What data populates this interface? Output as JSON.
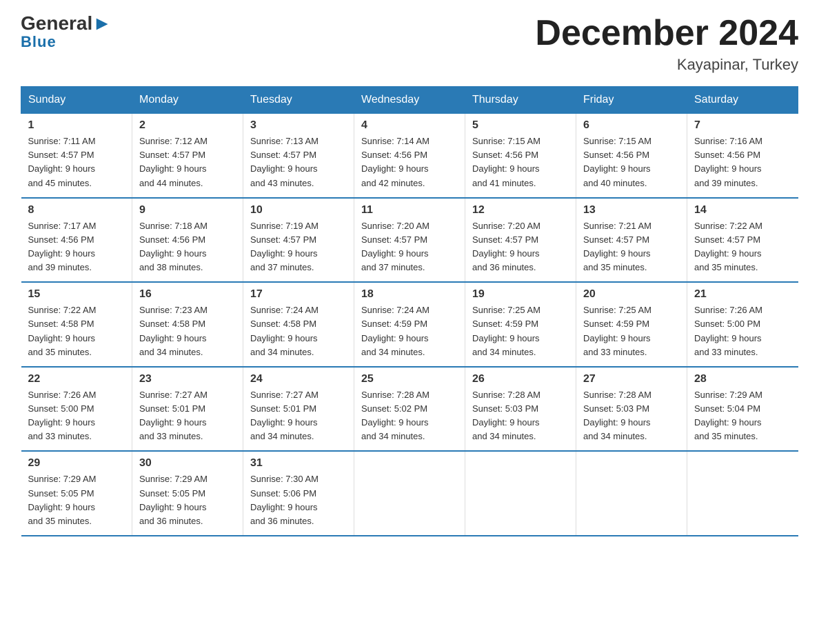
{
  "header": {
    "logo_general": "General",
    "logo_blue": "Blue",
    "month_title": "December 2024",
    "location": "Kayapinar, Turkey"
  },
  "days_of_week": [
    "Sunday",
    "Monday",
    "Tuesday",
    "Wednesday",
    "Thursday",
    "Friday",
    "Saturday"
  ],
  "weeks": [
    [
      {
        "num": "1",
        "sunrise": "7:11 AM",
        "sunset": "4:57 PM",
        "daylight": "9 hours and 45 minutes."
      },
      {
        "num": "2",
        "sunrise": "7:12 AM",
        "sunset": "4:57 PM",
        "daylight": "9 hours and 44 minutes."
      },
      {
        "num": "3",
        "sunrise": "7:13 AM",
        "sunset": "4:57 PM",
        "daylight": "9 hours and 43 minutes."
      },
      {
        "num": "4",
        "sunrise": "7:14 AM",
        "sunset": "4:56 PM",
        "daylight": "9 hours and 42 minutes."
      },
      {
        "num": "5",
        "sunrise": "7:15 AM",
        "sunset": "4:56 PM",
        "daylight": "9 hours and 41 minutes."
      },
      {
        "num": "6",
        "sunrise": "7:15 AM",
        "sunset": "4:56 PM",
        "daylight": "9 hours and 40 minutes."
      },
      {
        "num": "7",
        "sunrise": "7:16 AM",
        "sunset": "4:56 PM",
        "daylight": "9 hours and 39 minutes."
      }
    ],
    [
      {
        "num": "8",
        "sunrise": "7:17 AM",
        "sunset": "4:56 PM",
        "daylight": "9 hours and 39 minutes."
      },
      {
        "num": "9",
        "sunrise": "7:18 AM",
        "sunset": "4:56 PM",
        "daylight": "9 hours and 38 minutes."
      },
      {
        "num": "10",
        "sunrise": "7:19 AM",
        "sunset": "4:57 PM",
        "daylight": "9 hours and 37 minutes."
      },
      {
        "num": "11",
        "sunrise": "7:20 AM",
        "sunset": "4:57 PM",
        "daylight": "9 hours and 37 minutes."
      },
      {
        "num": "12",
        "sunrise": "7:20 AM",
        "sunset": "4:57 PM",
        "daylight": "9 hours and 36 minutes."
      },
      {
        "num": "13",
        "sunrise": "7:21 AM",
        "sunset": "4:57 PM",
        "daylight": "9 hours and 35 minutes."
      },
      {
        "num": "14",
        "sunrise": "7:22 AM",
        "sunset": "4:57 PM",
        "daylight": "9 hours and 35 minutes."
      }
    ],
    [
      {
        "num": "15",
        "sunrise": "7:22 AM",
        "sunset": "4:58 PM",
        "daylight": "9 hours and 35 minutes."
      },
      {
        "num": "16",
        "sunrise": "7:23 AM",
        "sunset": "4:58 PM",
        "daylight": "9 hours and 34 minutes."
      },
      {
        "num": "17",
        "sunrise": "7:24 AM",
        "sunset": "4:58 PM",
        "daylight": "9 hours and 34 minutes."
      },
      {
        "num": "18",
        "sunrise": "7:24 AM",
        "sunset": "4:59 PM",
        "daylight": "9 hours and 34 minutes."
      },
      {
        "num": "19",
        "sunrise": "7:25 AM",
        "sunset": "4:59 PM",
        "daylight": "9 hours and 34 minutes."
      },
      {
        "num": "20",
        "sunrise": "7:25 AM",
        "sunset": "4:59 PM",
        "daylight": "9 hours and 33 minutes."
      },
      {
        "num": "21",
        "sunrise": "7:26 AM",
        "sunset": "5:00 PM",
        "daylight": "9 hours and 33 minutes."
      }
    ],
    [
      {
        "num": "22",
        "sunrise": "7:26 AM",
        "sunset": "5:00 PM",
        "daylight": "9 hours and 33 minutes."
      },
      {
        "num": "23",
        "sunrise": "7:27 AM",
        "sunset": "5:01 PM",
        "daylight": "9 hours and 33 minutes."
      },
      {
        "num": "24",
        "sunrise": "7:27 AM",
        "sunset": "5:01 PM",
        "daylight": "9 hours and 34 minutes."
      },
      {
        "num": "25",
        "sunrise": "7:28 AM",
        "sunset": "5:02 PM",
        "daylight": "9 hours and 34 minutes."
      },
      {
        "num": "26",
        "sunrise": "7:28 AM",
        "sunset": "5:03 PM",
        "daylight": "9 hours and 34 minutes."
      },
      {
        "num": "27",
        "sunrise": "7:28 AM",
        "sunset": "5:03 PM",
        "daylight": "9 hours and 34 minutes."
      },
      {
        "num": "28",
        "sunrise": "7:29 AM",
        "sunset": "5:04 PM",
        "daylight": "9 hours and 35 minutes."
      }
    ],
    [
      {
        "num": "29",
        "sunrise": "7:29 AM",
        "sunset": "5:05 PM",
        "daylight": "9 hours and 35 minutes."
      },
      {
        "num": "30",
        "sunrise": "7:29 AM",
        "sunset": "5:05 PM",
        "daylight": "9 hours and 36 minutes."
      },
      {
        "num": "31",
        "sunrise": "7:30 AM",
        "sunset": "5:06 PM",
        "daylight": "9 hours and 36 minutes."
      },
      null,
      null,
      null,
      null
    ]
  ],
  "labels": {
    "sunrise": "Sunrise:",
    "sunset": "Sunset:",
    "daylight": "Daylight:"
  }
}
